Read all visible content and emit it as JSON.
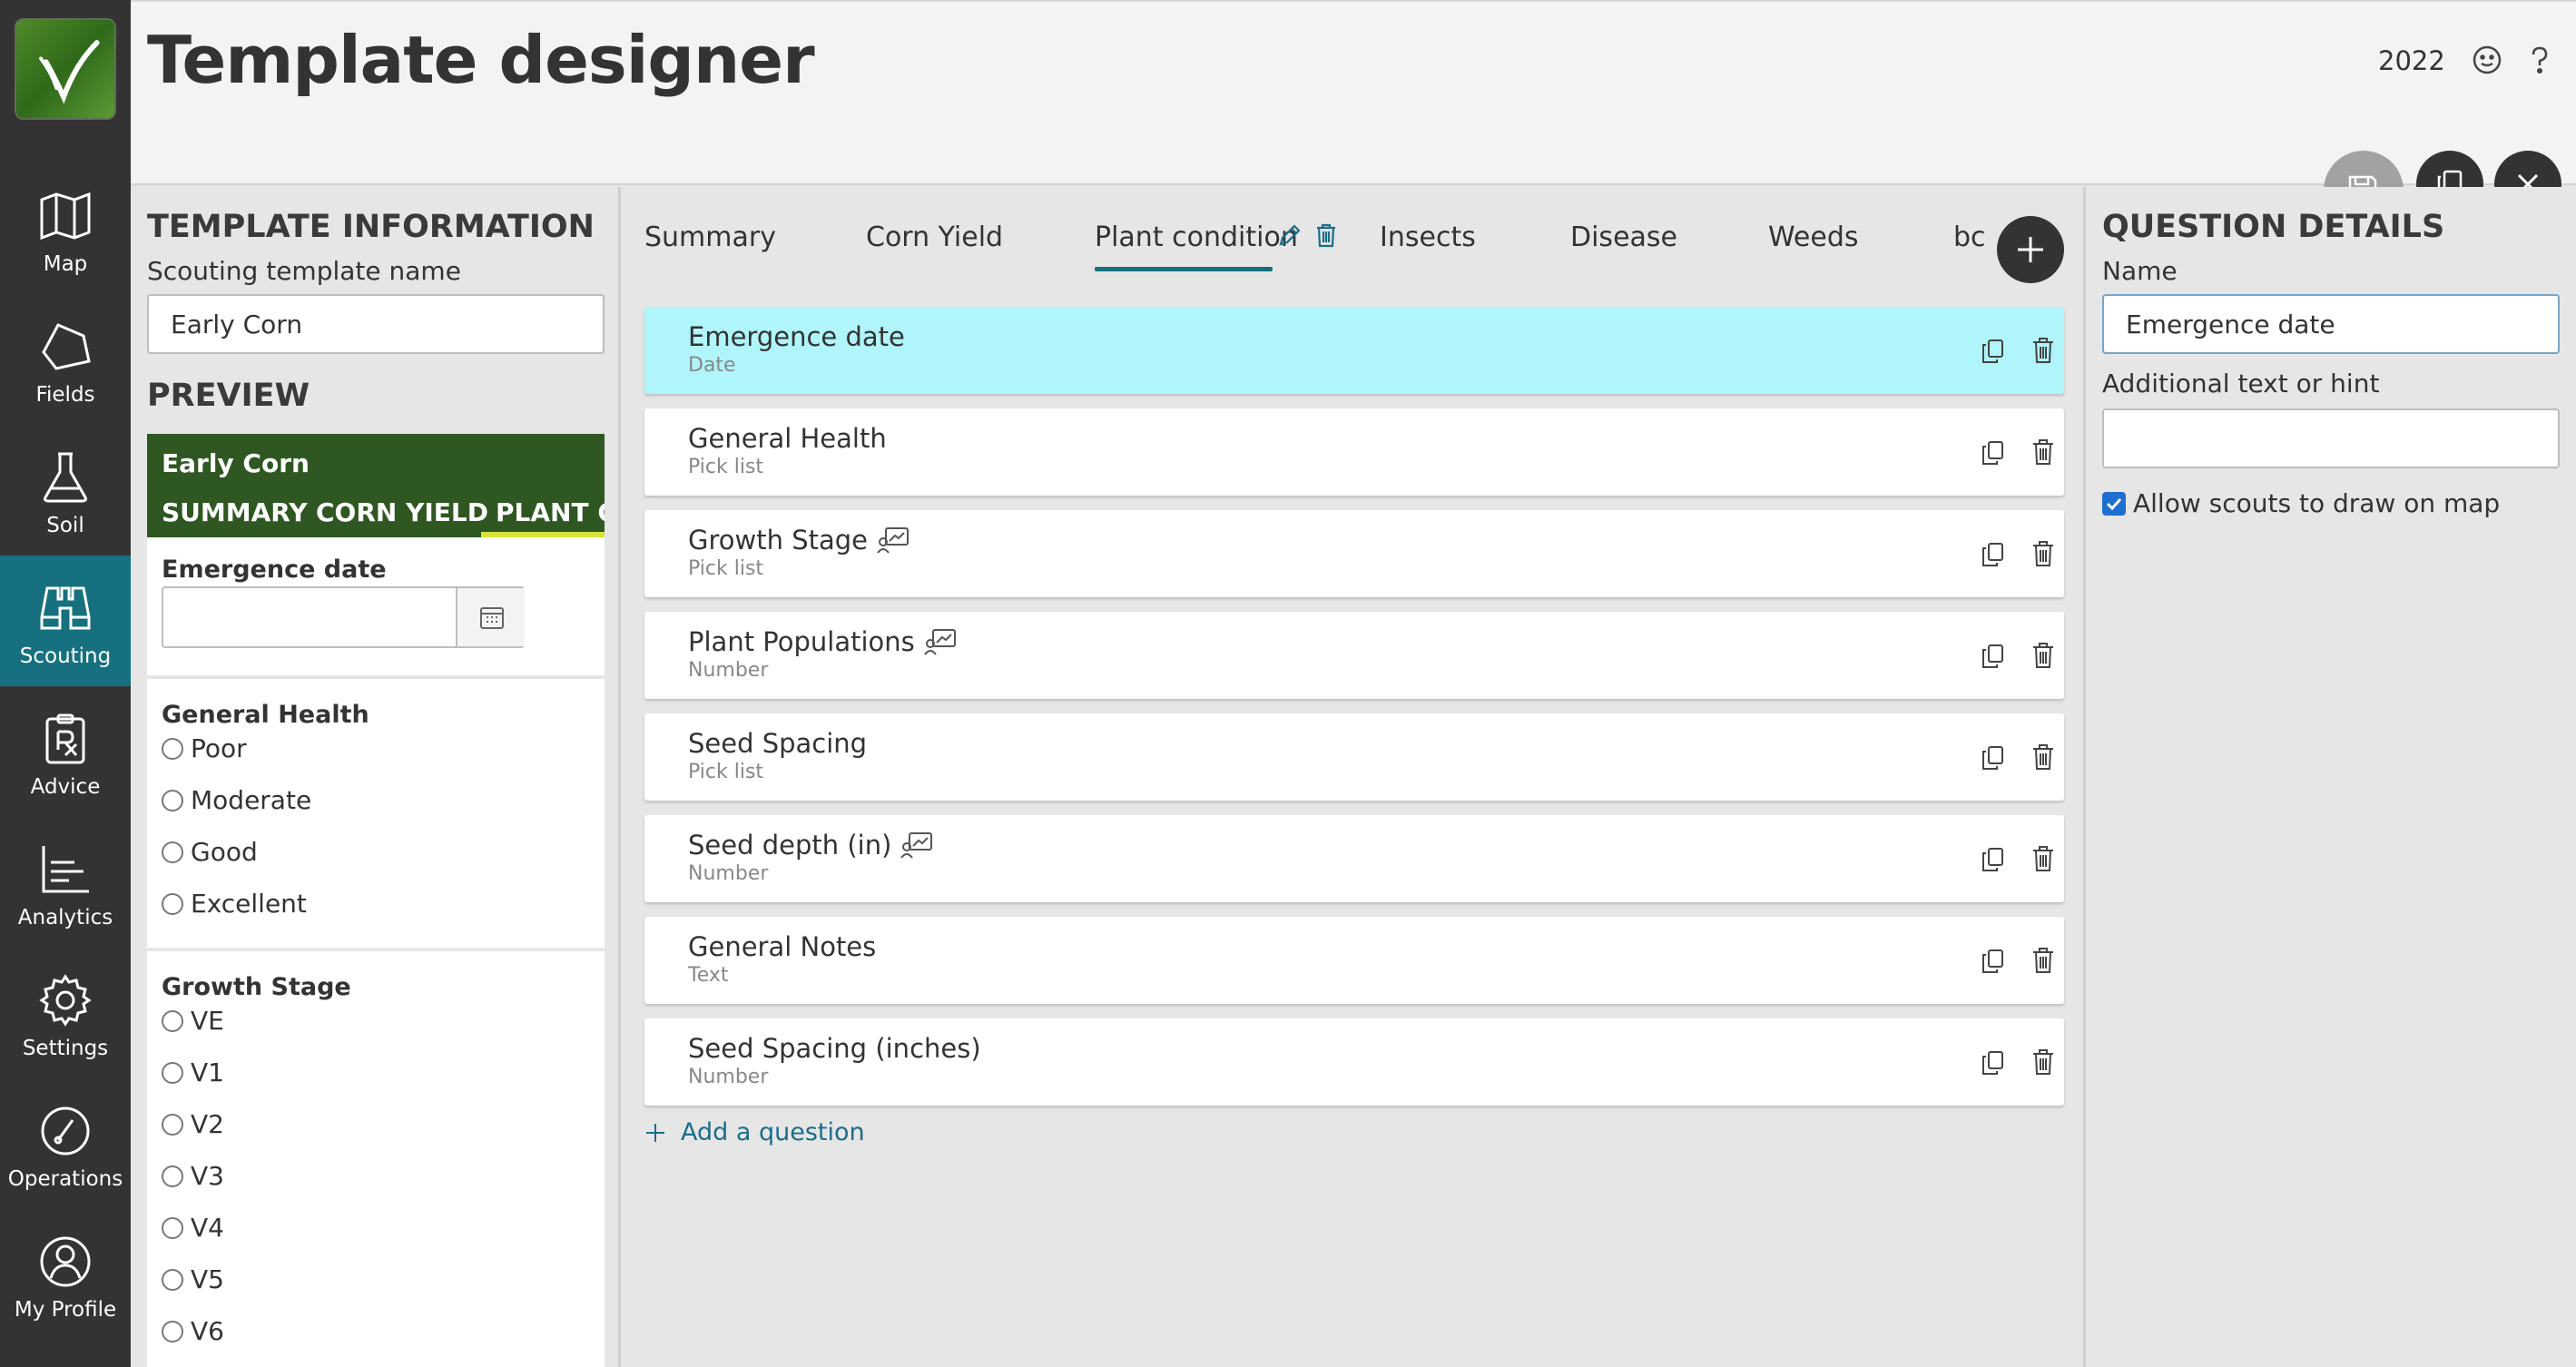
{
  "app": {
    "title": "Template designer",
    "year": "2022",
    "icons": [
      "feedback-icon",
      "help-icon"
    ]
  },
  "nav": {
    "logo": "leaf-logo",
    "items": [
      {
        "label": "Map",
        "icon": "map-icon"
      },
      {
        "label": "Fields",
        "icon": "fields-icon"
      },
      {
        "label": "Soil",
        "icon": "flask-icon"
      },
      {
        "label": "Scouting",
        "icon": "binoculars-icon",
        "active": true
      },
      {
        "label": "Advice",
        "icon": "prescription-icon"
      },
      {
        "label": "Analytics",
        "icon": "chart-icon"
      },
      {
        "label": "Settings",
        "icon": "gear-icon"
      },
      {
        "label": "Operations",
        "icon": "gauge-icon"
      },
      {
        "label": "My Profile",
        "icon": "user-icon"
      }
    ]
  },
  "actions": {
    "save": "save-icon",
    "copy": "copy-icon",
    "close": "close-icon"
  },
  "template_info": {
    "heading": "TEMPLATE INFORMATION",
    "name_label": "Scouting template name",
    "name_value": "Early Corn",
    "preview_heading": "PREVIEW"
  },
  "preview": {
    "name": "Early Corn",
    "tabs": [
      "SUMMARY",
      "CORN YIELD",
      "PLANT CONDITION"
    ],
    "emergence_label": "Emergence date",
    "general_health": {
      "label": "General Health",
      "options": [
        "Poor",
        "Moderate",
        "Good",
        "Excellent"
      ]
    },
    "growth_stage": {
      "label": "Growth Stage",
      "options": [
        "VE",
        "V1",
        "V2",
        "V3",
        "V4",
        "V5",
        "V6"
      ]
    }
  },
  "tabs": [
    {
      "label": "Summary"
    },
    {
      "label": "Corn Yield"
    },
    {
      "label": "Plant condition",
      "active": true
    },
    {
      "label": "Insects"
    },
    {
      "label": "Disease"
    },
    {
      "label": "Weeds"
    },
    {
      "label": "bc"
    }
  ],
  "questions": [
    {
      "title": "Emergence date",
      "type": "Date",
      "map": false,
      "selected": true
    },
    {
      "title": "General Health",
      "type": "Pick list",
      "map": false
    },
    {
      "title": "Growth Stage",
      "type": "Pick list",
      "map": true
    },
    {
      "title": "Plant Populations",
      "type": "Number",
      "map": true
    },
    {
      "title": "Seed Spacing",
      "type": "Pick list",
      "map": false
    },
    {
      "title": "Seed depth (in)",
      "type": "Number",
      "map": true
    },
    {
      "title": "General Notes",
      "type": "Text",
      "map": false
    },
    {
      "title": "Seed Spacing (inches)",
      "type": "Number",
      "map": false
    }
  ],
  "add_question": "Add a question",
  "details": {
    "heading": "QUESTION DETAILS",
    "name_label": "Name",
    "name_value": "Emergence date",
    "hint_label": "Additional text or hint",
    "hint_value": "",
    "draw_label": "Allow scouts to draw on map",
    "draw_checked": true
  },
  "colors": {
    "nav_bg": "#333333",
    "nav_active": "#16707f",
    "preview_header": "#2e5721",
    "preview_tab_accent": "#d7e33b",
    "selected_question": "#aff5fa",
    "link": "#1b6d8c",
    "checkbox": "#1f6fd1"
  }
}
